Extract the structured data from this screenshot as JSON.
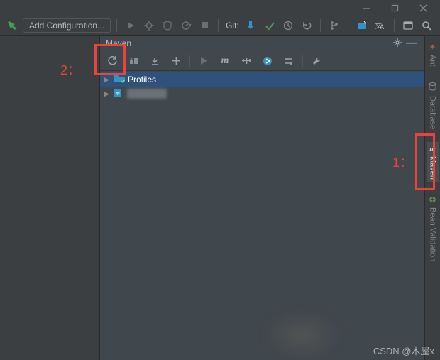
{
  "window": {
    "minimize": "—",
    "maximize": "▢",
    "close": "✕"
  },
  "toolbar": {
    "hammer": "build",
    "run_config": "Add Configuration...",
    "git_label": "Git:"
  },
  "panel": {
    "title": "Maven",
    "tree": {
      "profiles": "Profiles"
    }
  },
  "rail": {
    "ant": "Ant",
    "database": "Database",
    "maven": "Maven",
    "bean": "Bean Validation"
  },
  "annot": {
    "one": "1：",
    "two": "2："
  },
  "watermark": "CSDN @木屋x"
}
